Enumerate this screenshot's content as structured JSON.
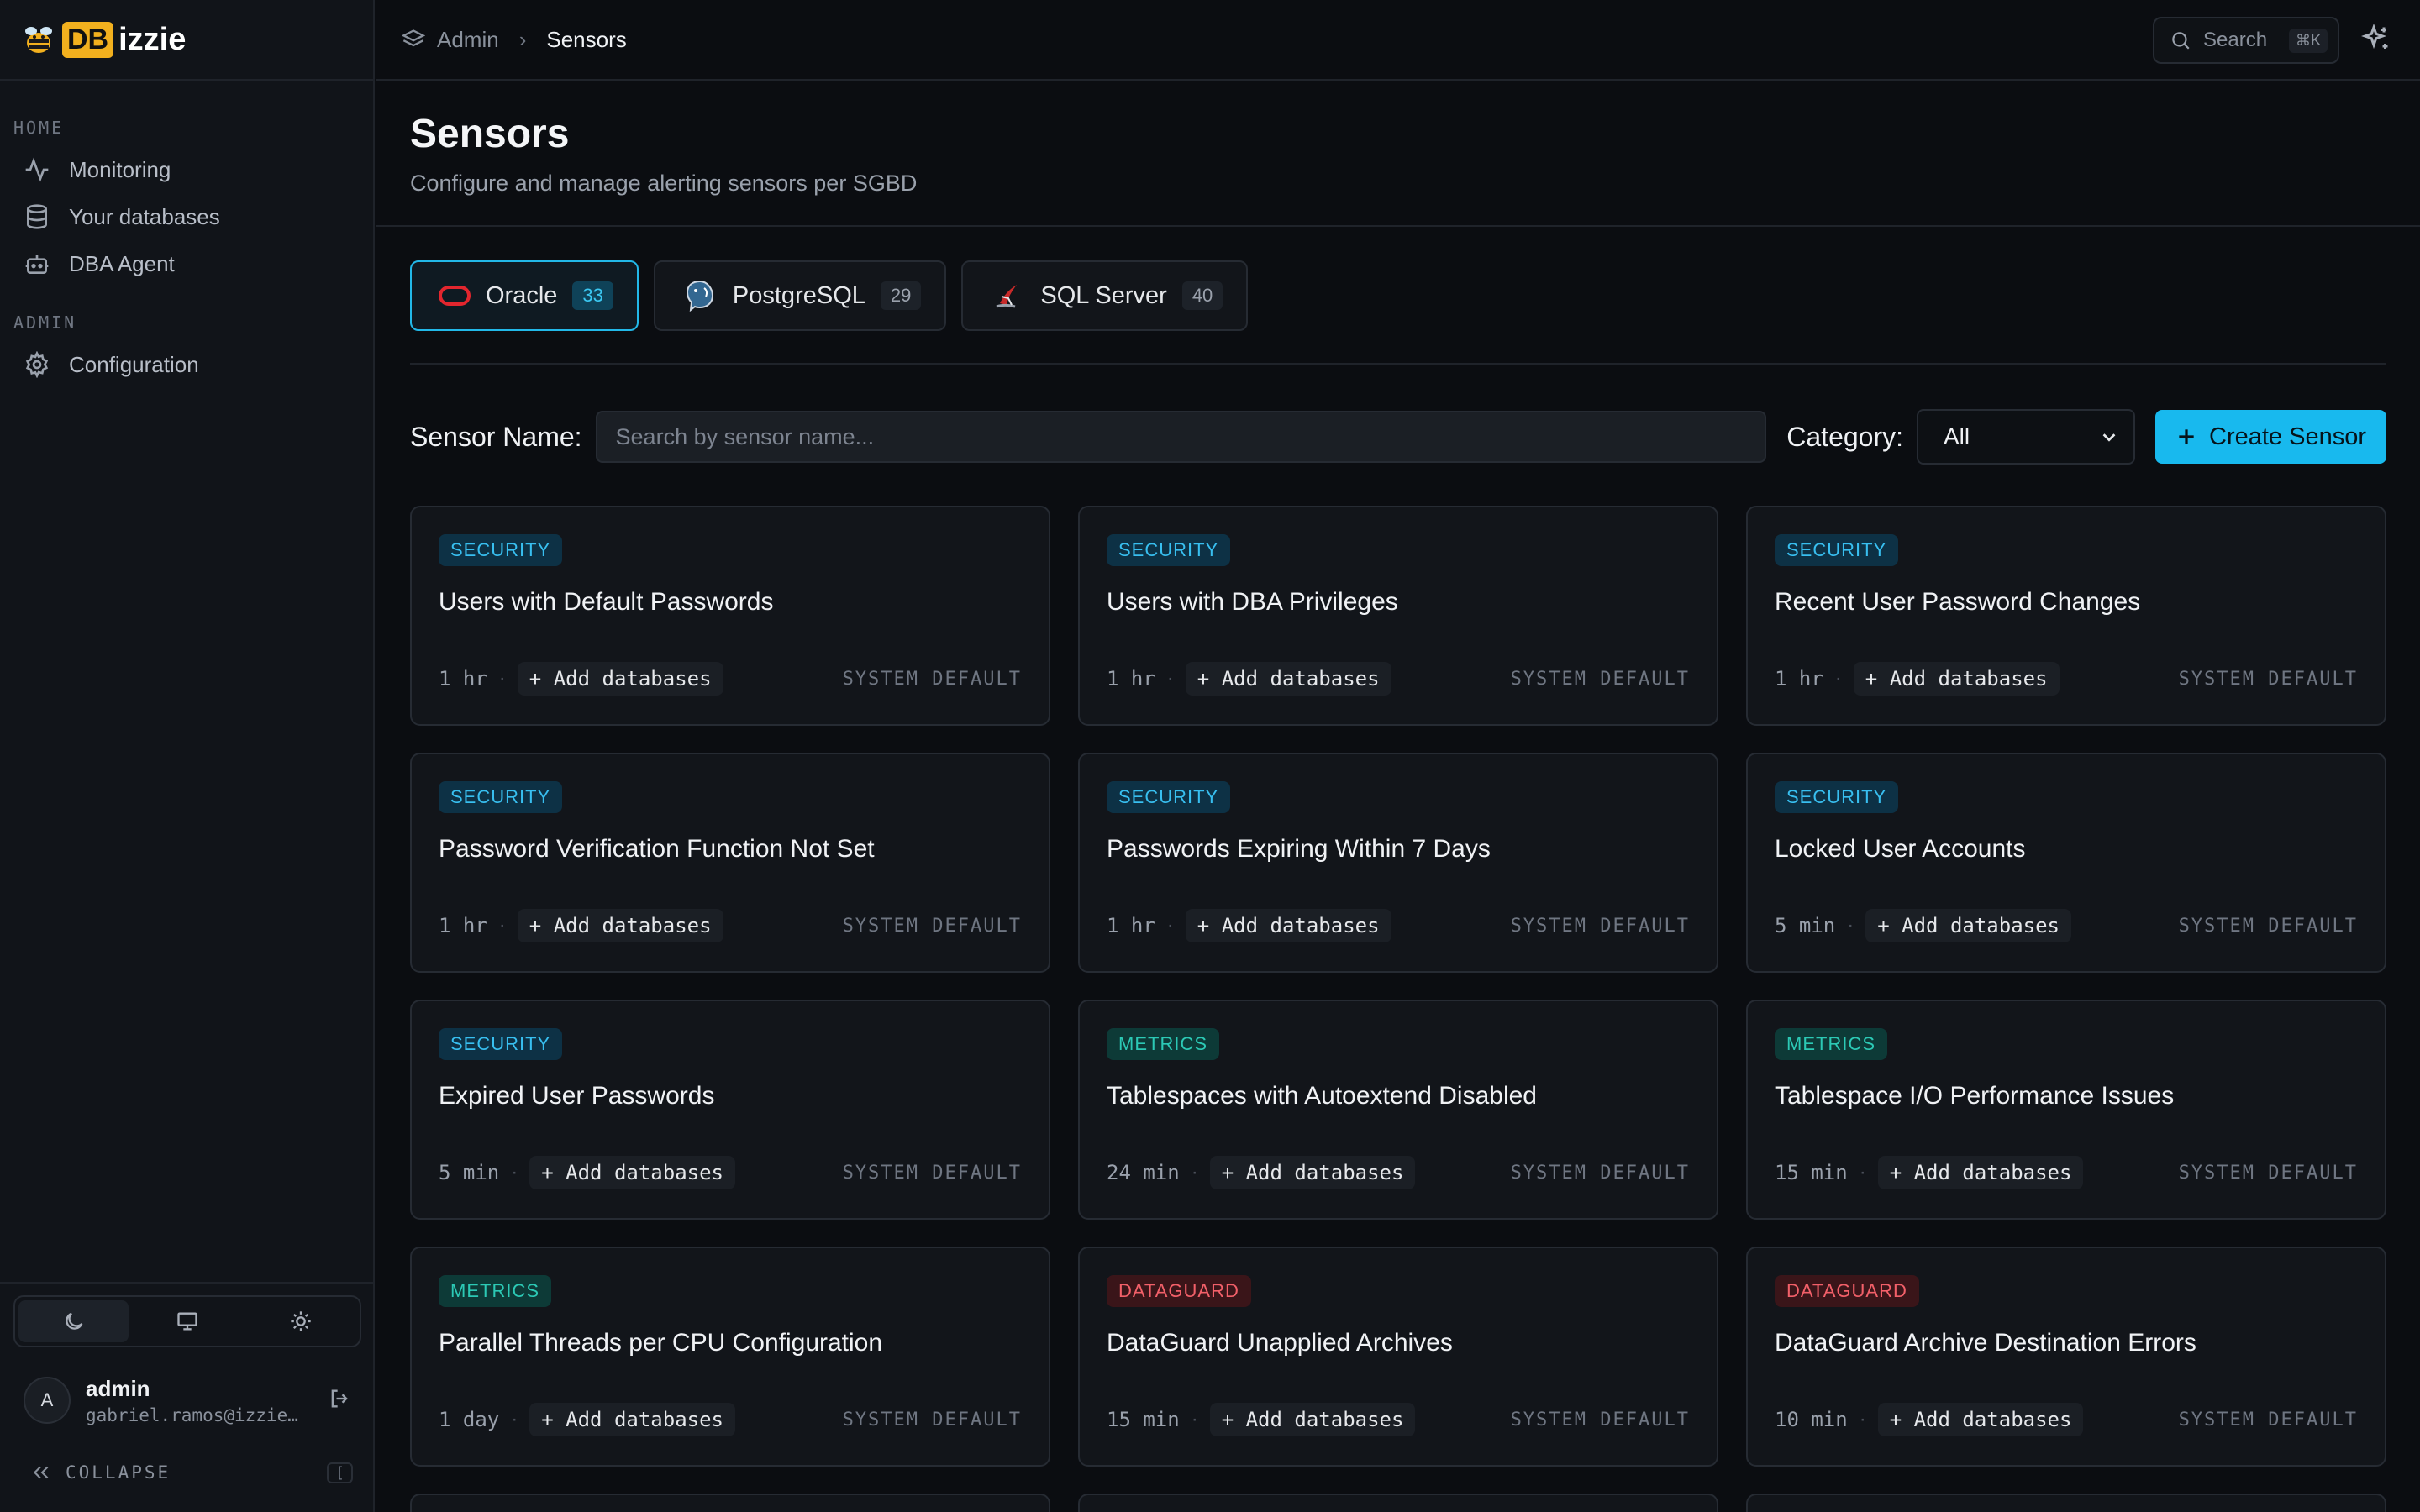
{
  "brand": {
    "prefix": "DB",
    "suffix": "izzie"
  },
  "sidebar": {
    "sections": [
      {
        "label": "HOME",
        "items": [
          {
            "label": "Monitoring",
            "icon": "activity-icon"
          },
          {
            "label": "Your databases",
            "icon": "database-icon"
          },
          {
            "label": "DBA Agent",
            "icon": "bot-icon"
          }
        ]
      },
      {
        "label": "ADMIN",
        "items": [
          {
            "label": "Configuration",
            "icon": "gear-icon"
          }
        ]
      }
    ],
    "theme": {
      "options": [
        "dark",
        "system",
        "light"
      ],
      "active": "dark"
    },
    "user": {
      "initial": "A",
      "name": "admin",
      "email": "gabriel.ramos@izzie…"
    },
    "collapse_label": "COLLAPSE",
    "collapse_shortcut": "["
  },
  "topbar": {
    "breadcrumb_root": "Admin",
    "breadcrumb_current": "Sensors",
    "search_label": "Search",
    "search_shortcut": "⌘K"
  },
  "page": {
    "title": "Sensors",
    "subtitle": "Configure and manage alerting sensors per SGBD"
  },
  "tabs": [
    {
      "label": "Oracle",
      "count": "33",
      "active": true
    },
    {
      "label": "PostgreSQL",
      "count": "29",
      "active": false
    },
    {
      "label": "SQL Server",
      "count": "40",
      "active": false
    }
  ],
  "filters": {
    "sensor_name_label": "Sensor Name:",
    "sensor_name_placeholder": "Search by sensor name...",
    "category_label": "Category:",
    "category_value": "All",
    "create_button": "Create Sensor"
  },
  "card_common": {
    "add_label": "+ Add databases",
    "system_default": "SYSTEM DEFAULT"
  },
  "cards": [
    {
      "category": "SECURITY",
      "title": "Users with Default Passwords",
      "interval": "1 hr"
    },
    {
      "category": "SECURITY",
      "title": "Users with DBA Privileges",
      "interval": "1 hr"
    },
    {
      "category": "SECURITY",
      "title": "Recent User Password Changes",
      "interval": "1 hr"
    },
    {
      "category": "SECURITY",
      "title": "Password Verification Function Not Set",
      "interval": "1 hr"
    },
    {
      "category": "SECURITY",
      "title": "Passwords Expiring Within 7 Days",
      "interval": "1 hr"
    },
    {
      "category": "SECURITY",
      "title": "Locked User Accounts",
      "interval": "5 min"
    },
    {
      "category": "SECURITY",
      "title": "Expired User Passwords",
      "interval": "5 min"
    },
    {
      "category": "METRICS",
      "title": "Tablespaces with Autoextend Disabled",
      "interval": "24 min"
    },
    {
      "category": "METRICS",
      "title": "Tablespace I/O Performance Issues",
      "interval": "15 min"
    },
    {
      "category": "METRICS",
      "title": "Parallel Threads per CPU Configuration",
      "interval": "1 day"
    },
    {
      "category": "DATAGUARD",
      "title": "DataGuard Unapplied Archives",
      "interval": "15 min"
    },
    {
      "category": "DATAGUARD",
      "title": "DataGuard Archive Destination Errors",
      "interval": "10 min"
    }
  ],
  "colors": {
    "accent": "#18b9ee",
    "security": "#38bff0",
    "metrics": "#2cc9b5",
    "dataguard": "#f26069",
    "brand_yellow": "#f2b01e"
  }
}
